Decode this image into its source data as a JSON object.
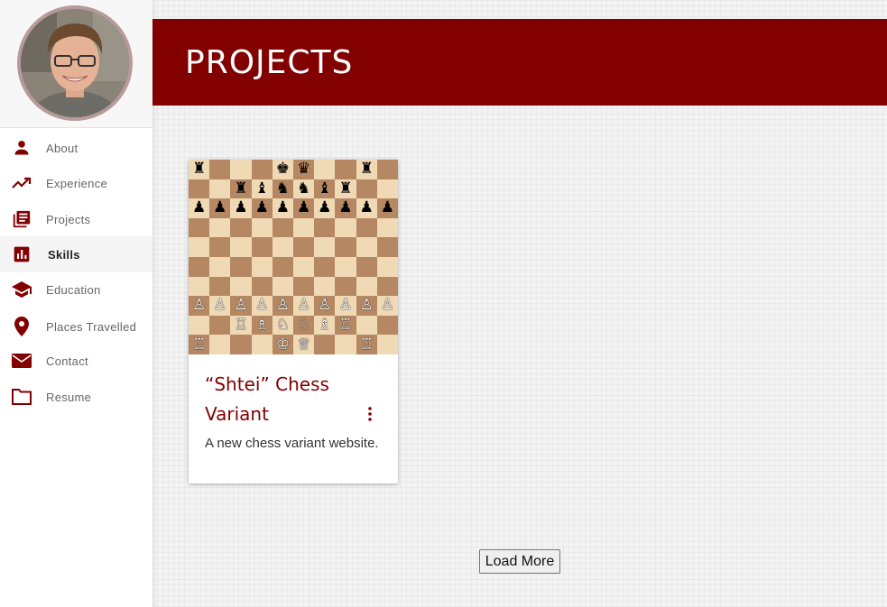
{
  "sidebar": {
    "items": [
      {
        "label": "About",
        "icon": "person-icon"
      },
      {
        "label": "Experience",
        "icon": "trending-up-icon"
      },
      {
        "label": "Projects",
        "icon": "library-books-icon"
      },
      {
        "label": "Skills",
        "icon": "bar-chart-icon",
        "active": true
      },
      {
        "label": "Education",
        "icon": "graduation-cap-icon"
      },
      {
        "label": "Places Travelled",
        "icon": "location-pin-icon"
      },
      {
        "label": "Contact",
        "icon": "mail-icon"
      },
      {
        "label": "Resume",
        "icon": "folder-icon"
      }
    ]
  },
  "header": {
    "title": "PROJECTS"
  },
  "projects": [
    {
      "title": "“Shtei” Chess Variant",
      "description": "A new chess variant website.",
      "board": [
        "♜   ♚♛  ♜",
        "  ♜♝♞♞♝♜  ",
        "♟♟♟♟♟♟♟♟♟♟",
        "          ",
        "          ",
        "          ",
        "          ",
        "♙♙♙♙♙♙♙♙♙♙",
        "  ♖♗♘♘♗♖  ",
        "♖   ♔♕  ♖"
      ]
    }
  ],
  "load_more": "Load More",
  "colors": {
    "accent": "#820000",
    "board_light": "#f0d9b5",
    "board_dark": "#b58863"
  }
}
